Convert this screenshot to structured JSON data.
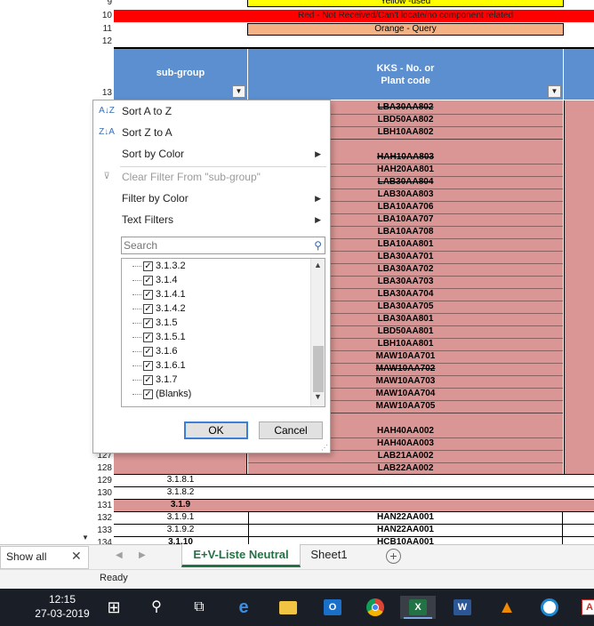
{
  "legend": {
    "yellow": "Yellow -used",
    "red": "Red - Not Received/Can't locate/no component related",
    "orange": "Orange - Query"
  },
  "colors": {
    "yellow": "#ffff00",
    "red": "#ff0000",
    "orange": "#f4b183",
    "header_blue": "#5b8fd0",
    "pink": "#da9694",
    "excel_green": "#217346"
  },
  "row_numbers": {
    "r9": "9",
    "r10": "10",
    "r11": "11",
    "r12": "12",
    "r13": "13",
    "r127": "127",
    "r128": "128",
    "r129": "129",
    "r130": "130",
    "r131": "131",
    "r132": "132",
    "r133": "133",
    "r134": "134"
  },
  "headers": {
    "subgroup": "sub-group",
    "kks_line1": "KKS - No. or",
    "kks_line2": "Plant code",
    "filter_glyph": "▼"
  },
  "kks_values": [
    {
      "text": "LBA30AA802",
      "strike": true
    },
    {
      "text": "LBD50AA802",
      "strike": false
    },
    {
      "text": "LBH10AA802",
      "strike": false
    },
    {
      "text": "",
      "strike": false
    },
    {
      "text": "HAH10AA803",
      "strike": true
    },
    {
      "text": "HAH20AA801",
      "strike": false
    },
    {
      "text": "LAB30AA804",
      "strike": true
    },
    {
      "text": "LAB30AA803",
      "strike": false
    },
    {
      "text": "LBA10AA706",
      "strike": false
    },
    {
      "text": "LBA10AA707",
      "strike": false
    },
    {
      "text": "LBA10AA708",
      "strike": false
    },
    {
      "text": "LBA10AA801",
      "strike": false
    },
    {
      "text": "LBA30AA701",
      "strike": false
    },
    {
      "text": "LBA30AA702",
      "strike": false
    },
    {
      "text": "LBA30AA703",
      "strike": false
    },
    {
      "text": "LBA30AA704",
      "strike": false
    },
    {
      "text": "LBA30AA705",
      "strike": false
    },
    {
      "text": "LBA30AA801",
      "strike": false
    },
    {
      "text": "LBD50AA801",
      "strike": false
    },
    {
      "text": "LBH10AA801",
      "strike": false
    },
    {
      "text": "MAW10AA701",
      "strike": false
    },
    {
      "text": "MAW10AA702",
      "strike": true
    },
    {
      "text": "MAW10AA703",
      "strike": false
    },
    {
      "text": "MAW10AA704",
      "strike": false
    },
    {
      "text": "MAW10AA705",
      "strike": false
    },
    {
      "text": "",
      "strike": false
    },
    {
      "text": "HAH40AA002",
      "strike": false
    },
    {
      "text": "HAH40AA003",
      "strike": false
    },
    {
      "text": "LAB21AA002",
      "strike": false
    },
    {
      "text": "LAB22AA002",
      "strike": false
    }
  ],
  "lower_rows": [
    {
      "sub": "3.1.8.1",
      "kks": "",
      "bold": false
    },
    {
      "sub": "3.1.8.2",
      "kks": "",
      "bold": false
    },
    {
      "sub": "3.1.9",
      "kks": "",
      "bold": true
    },
    {
      "sub": "3.1.9.1",
      "kks": "HAN22AA001",
      "bold": false
    },
    {
      "sub": "3.1.9.2",
      "kks": "HAN22AA001",
      "bold": false
    },
    {
      "sub": "3.1.10",
      "kks": "HCB10AA001",
      "bold": true
    }
  ],
  "filter_menu": {
    "sort_az": "Sort A to Z",
    "sort_za": "Sort Z to A",
    "sort_color": "Sort by Color",
    "clear_filter": "Clear Filter From \"sub-group\"",
    "filter_color": "Filter by Color",
    "text_filters": "Text Filters",
    "search_placeholder": "Search",
    "items": [
      "3.1.3.2",
      "3.1.4",
      "3.1.4.1",
      "3.1.4.2",
      "3.1.5",
      "3.1.5.1",
      "3.1.6",
      "3.1.6.1",
      "3.1.7",
      "(Blanks)"
    ],
    "ok": "OK",
    "cancel": "Cancel"
  },
  "tabs": {
    "show_all": "Show all",
    "active": "E+V-Liste Neutral",
    "sheet1": "Sheet1",
    "add": "+"
  },
  "status": "Ready",
  "taskbar": {
    "time": "12:15",
    "date": "27-03-2019",
    "icons": [
      "windows-icon",
      "search-icon",
      "task-view-icon",
      "edge-icon",
      "file-explorer-icon",
      "outlook-icon",
      "chrome-icon",
      "excel-icon",
      "word-icon",
      "vlc-icon",
      "app-icon",
      "acrobat-icon"
    ]
  }
}
